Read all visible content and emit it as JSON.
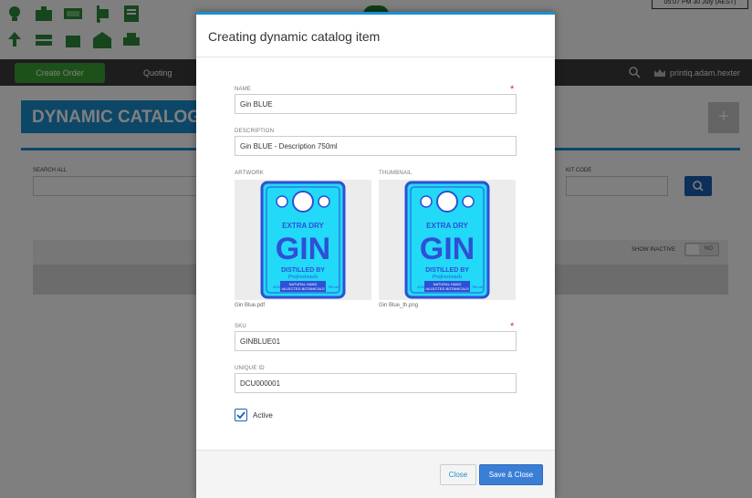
{
  "header": {
    "datetime": "05:07 PM 30 July (AEST)"
  },
  "navbar": {
    "create_order": "Create Order",
    "quoting": "Quoting",
    "user": "printiq.adam.hexter"
  },
  "page": {
    "title": "DYNAMIC CATALOG",
    "add_label": "+",
    "search_all_label": "SEARCH ALL",
    "kit_code_label": "KIT CODE",
    "show_inactive_label": "SHOW INACTIVE",
    "toggle_value": "NO"
  },
  "modal": {
    "title": "Creating dynamic catalog item",
    "name_label": "NAME",
    "name_value": "Gin BLUE",
    "description_label": "DESCRIPTION",
    "description_value": "Gin BLUE - Description 750ml",
    "artwork_label": "ARTWORK",
    "thumbnail_label": "THUMBNAIL",
    "artwork_caption": "Gin Blue.pdf",
    "thumbnail_caption": "Gin Blue_th.png",
    "sku_label": "SKU",
    "sku_value": "GINBLUE01",
    "unique_id_label": "UNIQUE ID",
    "unique_id_value": "DCU000001",
    "active_label": "Active",
    "required_mark": "*",
    "close_button": "Close",
    "save_button": "Save & Close"
  },
  "label_art": {
    "line1": "EXTRA DRY",
    "line2": "GIN",
    "line3": "DISTILLED BY",
    "line4": "Professionals",
    "line5": "NATURAL HAND",
    "line6": "SELECTED BOTANICALS",
    "vol": "42% alc",
    "size": "750 ml"
  },
  "colors": {
    "accent": "#1a8fd0",
    "nav_bg": "#3a3a3a",
    "create_green": "#3aa335",
    "label_blue": "#2f4fd6",
    "label_cyan": "#22d9f7"
  }
}
